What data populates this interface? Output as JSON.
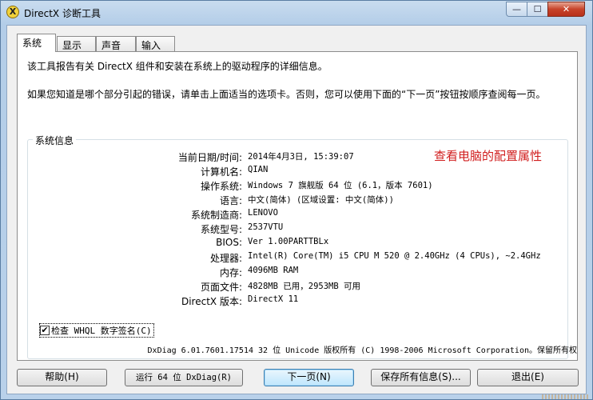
{
  "window": {
    "title": "DirectX 诊断工具",
    "app_icon": "X",
    "min": "—",
    "max": "☐",
    "close": "✕"
  },
  "tabs": [
    "系统",
    "显示",
    "声音",
    "输入"
  ],
  "intro": {
    "line1": "该工具报告有关 DirectX 组件和安装在系统上的驱动程序的详细信息。",
    "line2": "如果您知道是哪个部分引起的错误，请单击上面适当的选项卡。否则，您可以使用下面的“下一页”按钮按顺序查阅每一页。"
  },
  "sysinfo": {
    "group_title": "系统信息",
    "note": "查看电脑的配置属性",
    "rows": [
      {
        "label": "当前日期/时间:",
        "value": "2014年4月3日, 15:39:07"
      },
      {
        "label": "计算机名:",
        "value": "QIAN"
      },
      {
        "label": "操作系统:",
        "value": "Windows 7 旗舰版 64 位 (6.1，版本 7601)"
      },
      {
        "label": "语言:",
        "value": "中文(简体) (区域设置: 中文(简体))"
      },
      {
        "label": "系统制造商:",
        "value": "LENOVO"
      },
      {
        "label": "系统型号:",
        "value": "2537VTU"
      },
      {
        "label": "BIOS:",
        "value": "Ver 1.00PARTTBLx"
      },
      {
        "label": "处理器:",
        "value": "Intel(R) Core(TM) i5 CPU       M 520  @ 2.40GHz (4 CPUs), ~2.4GHz"
      },
      {
        "label": "内存:",
        "value": "4096MB RAM"
      },
      {
        "label": "页面文件:",
        "value": "4828MB 已用，2953MB 可用"
      },
      {
        "label": "DirectX 版本:",
        "value": "DirectX 11"
      }
    ],
    "checkbox": {
      "label": "检查 WHQL 数字签名(C)",
      "checked": true,
      "mark": "✔"
    }
  },
  "footer": "DxDiag 6.01.7601.17514 32 位 Unicode 版权所有 (C) 1998-2006 Microsoft Corporation。保留所有权",
  "buttons": {
    "help": "帮助(H)",
    "run64": "运行 64 位 DxDiag(R)",
    "next": "下一页(N)",
    "save": "保存所有信息(S)...",
    "exit": "退出(E)"
  }
}
